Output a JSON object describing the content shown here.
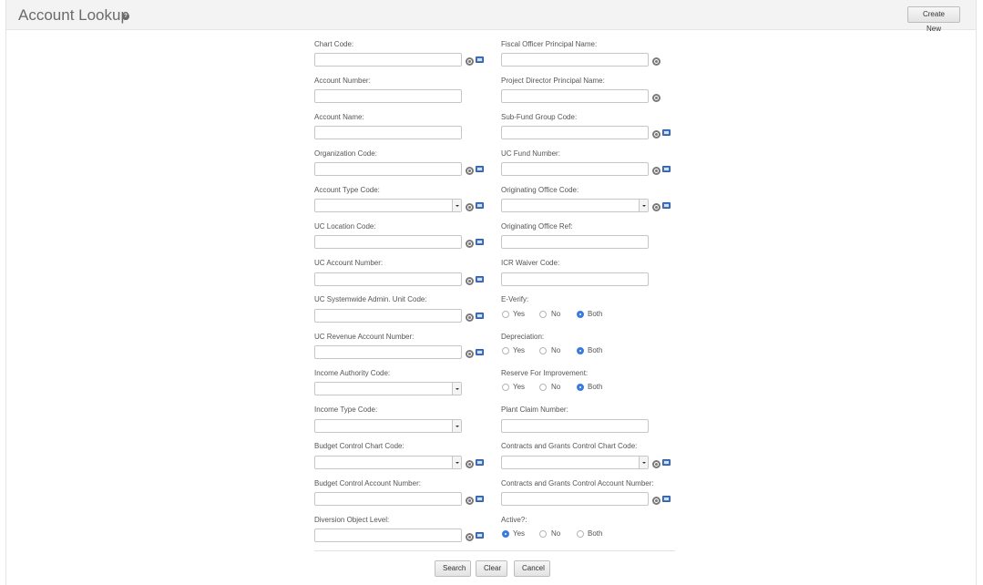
{
  "header": {
    "title": "Account Lookup",
    "help_icon": "?",
    "create_new_label": "Create New"
  },
  "left": {
    "chart_code": "Chart Code:",
    "account_number": "Account Number:",
    "account_name": "Account Name:",
    "organization_code": "Organization Code:",
    "account_type_code": "Account Type Code:",
    "uc_location_code": "UC Location Code:",
    "uc_account_number": "UC Account Number:",
    "uc_systemwide_admin_unit_code": "UC Systemwide Admin. Unit Code:",
    "uc_revenue_account_number": "UC Revenue Account Number:",
    "income_authority_code": "Income Authority Code:",
    "income_type_code": "Income Type Code:",
    "budget_control_chart_code": "Budget Control Chart Code:",
    "budget_control_account_number": "Budget Control Account Number:",
    "diversion_object_level": "Diversion Object Level:"
  },
  "right": {
    "fiscal_officer_principal_name": "Fiscal Officer Principal Name:",
    "project_director_principal_name": "Project Director Principal Name:",
    "sub_fund_group_code": "Sub-Fund Group Code:",
    "uc_fund_number": "UC Fund Number:",
    "originating_office_code": "Originating Office Code:",
    "originating_office_ref": "Originating Office Ref:",
    "icr_waiver_code": "ICR Waiver Code:",
    "e_verify": "E-Verify:",
    "depreciation": "Depreciation:",
    "reserve_for_improvement": "Reserve For Improvement:",
    "plant_claim_number": "Plant Claim Number:",
    "cg_control_chart_code": "Contracts and Grants Control Chart Code:",
    "cg_control_account_number": "Contracts and Grants Control Account Number:",
    "active": "Active?:"
  },
  "radio_options": {
    "yes": "Yes",
    "no": "No",
    "both": "Both"
  },
  "radio_selected": {
    "e_verify": "Both",
    "depreciation": "Both",
    "reserve_for_improvement": "Both",
    "active": "Yes"
  },
  "footer": {
    "search_label": "Search",
    "clear_label": "Clear",
    "cancel_label": "Cancel"
  },
  "colors": {
    "accent": "#3a7be0",
    "header_bg": "#f3f3f3",
    "book_icon": "#4a78c2"
  }
}
